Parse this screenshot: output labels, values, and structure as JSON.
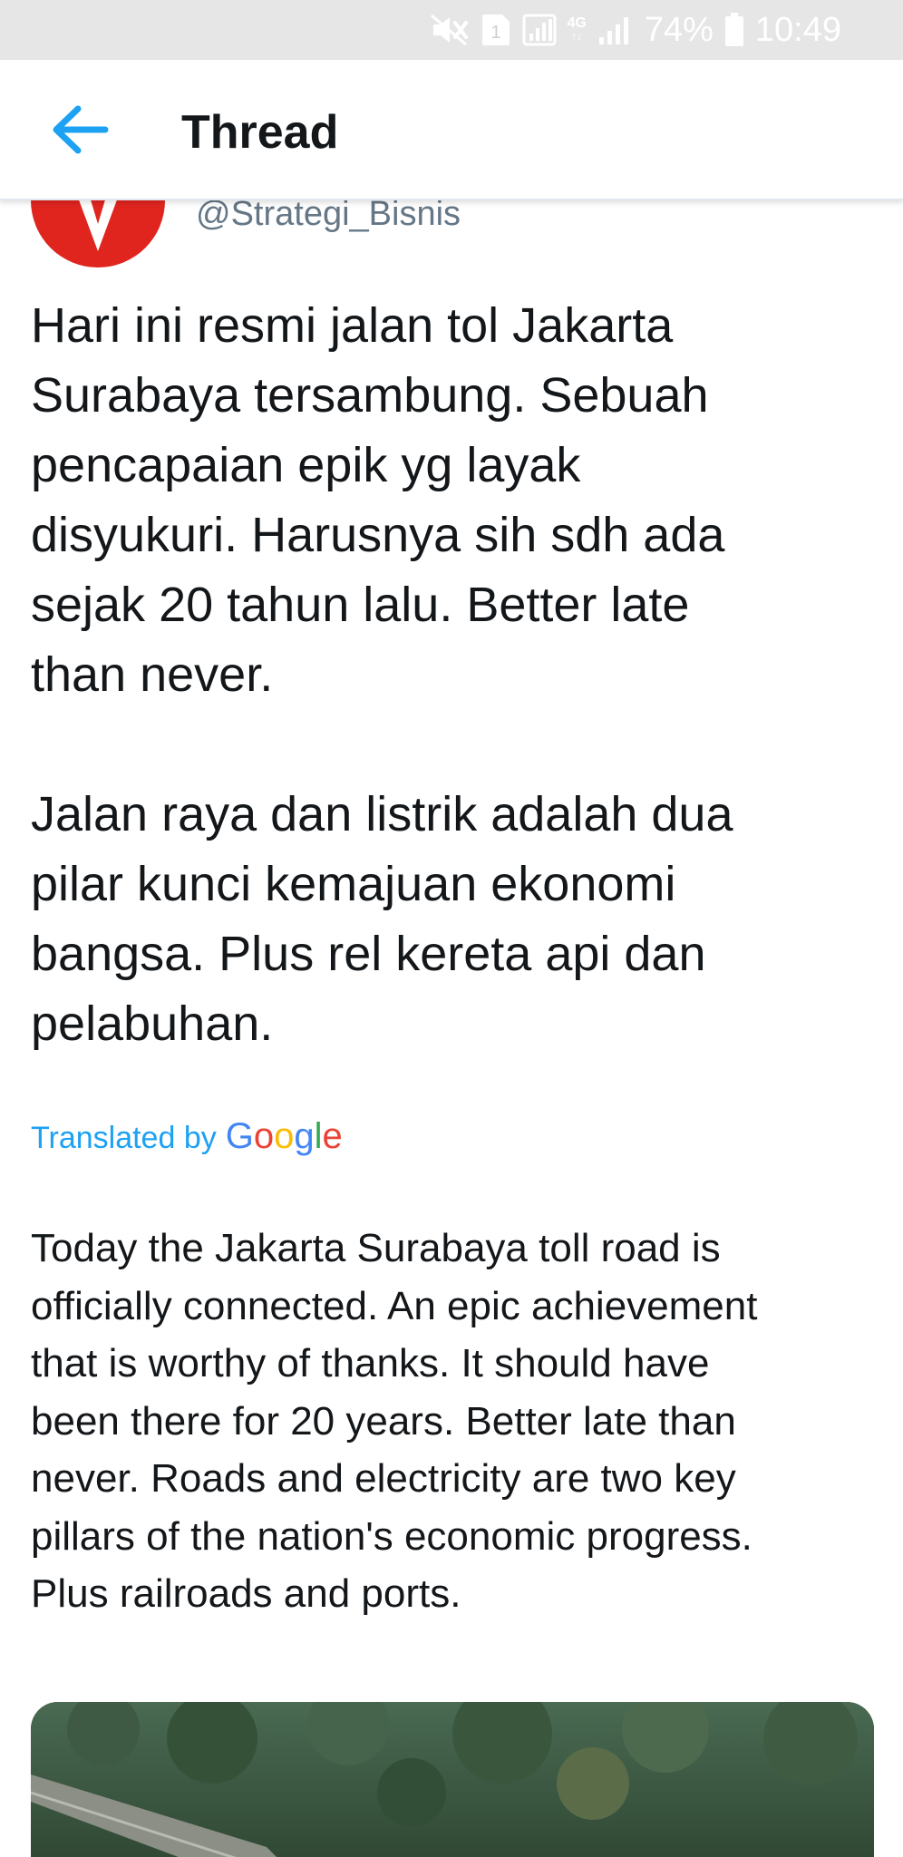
{
  "status_bar": {
    "network": "4G",
    "battery_percent": "74%",
    "time": "10:49",
    "sim_slot": "1",
    "icons": [
      "mute-icon",
      "sim-icon",
      "signal-box-icon",
      "network-4g-icon",
      "signal-icon",
      "battery-icon"
    ]
  },
  "header": {
    "title": "Thread",
    "back_icon": "back-arrow-icon"
  },
  "tweet": {
    "handle": "@Strategi_Bisnis",
    "text": "Hari ini resmi jalan tol Jakarta\nSurabaya tersambung. Sebuah\npencapaian epik yg layak\ndisyukuri. Harusnya sih sdh ada\nsejak 20 tahun lalu. Better late\nthan never.\n\nJalan raya dan listrik adalah dua\npilar kunci kemajuan ekonomi\nbangsa. Plus rel kereta api dan\npelabuhan.",
    "translated_by_label": "Translated by",
    "translator_name": "Google",
    "translation": "Today the Jakarta Surabaya toll road is\nofficially connected. An epic achievement\nthat is worthy of thanks. It should have\nbeen there for 20 years. Better late than\nnever. Roads and electricity are two key\npillars of the nation's economic progress.\nPlus railroads and ports."
  },
  "colors": {
    "accent": "#1da1f2",
    "text": "#14171a",
    "secondary_text": "#657786",
    "avatar_red": "#e0251f",
    "status_bar_bg": "#e6e6e6"
  }
}
